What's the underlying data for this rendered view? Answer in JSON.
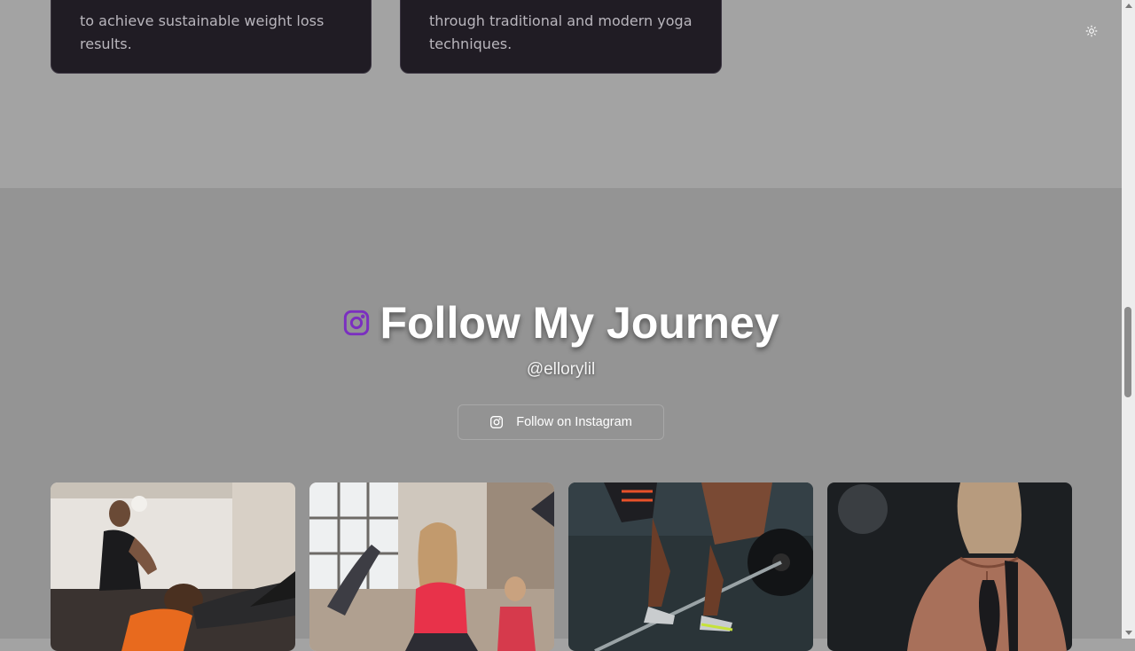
{
  "cards": [
    {
      "lines": [
        "to achieve sustainable weight loss",
        "results."
      ]
    },
    {
      "lines": [
        "through traditional and modern yoga",
        "techniques."
      ]
    }
  ],
  "theme_toggle": {
    "icon": "sun-icon"
  },
  "instagram": {
    "icon": "instagram-icon",
    "title": "Follow My Journey",
    "handle": "@ellorylil",
    "follow_button": {
      "label": "Follow on Instagram",
      "icon": "instagram-icon"
    },
    "photos": [
      {
        "name": "trainer-stretching-client-photo"
      },
      {
        "name": "woman-yoga-class-photo"
      },
      {
        "name": "barbell-deadlift-photo"
      },
      {
        "name": "muscular-back-photo"
      }
    ]
  },
  "colors": {
    "accent": "#7b2fc0",
    "card_bg": "#201c24",
    "section_bg": "#949494"
  }
}
